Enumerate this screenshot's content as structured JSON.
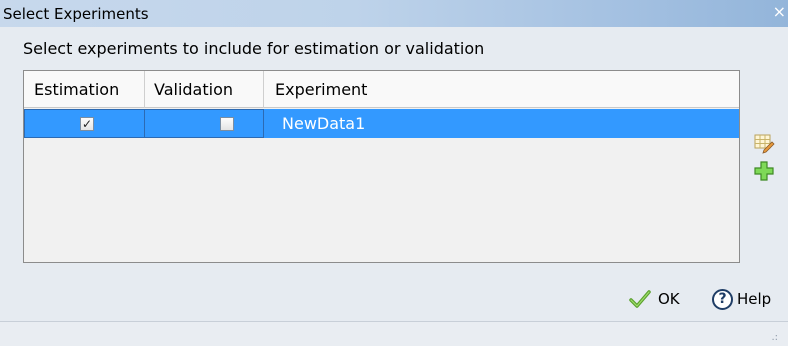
{
  "window": {
    "title": "Select Experiments",
    "close_glyph": "×"
  },
  "instruction": "Select experiments to include for estimation or validation",
  "table": {
    "columns": [
      "Estimation",
      "Validation",
      "Experiment"
    ],
    "rows": [
      {
        "estimation": true,
        "validation": false,
        "experiment": "NewData1",
        "selected": true
      }
    ],
    "check_glyph": "✓"
  },
  "side_buttons": [
    {
      "icon": "edit-table-icon"
    },
    {
      "icon": "add-icon"
    }
  ],
  "buttons": {
    "ok_label": "OK",
    "help_label": "Help",
    "help_glyph": "?"
  },
  "grip_glyph": ".:",
  "colors": {
    "selection": "#3399ff",
    "titlebar": "#bed3ea",
    "add_icon": "#5fc23a"
  }
}
